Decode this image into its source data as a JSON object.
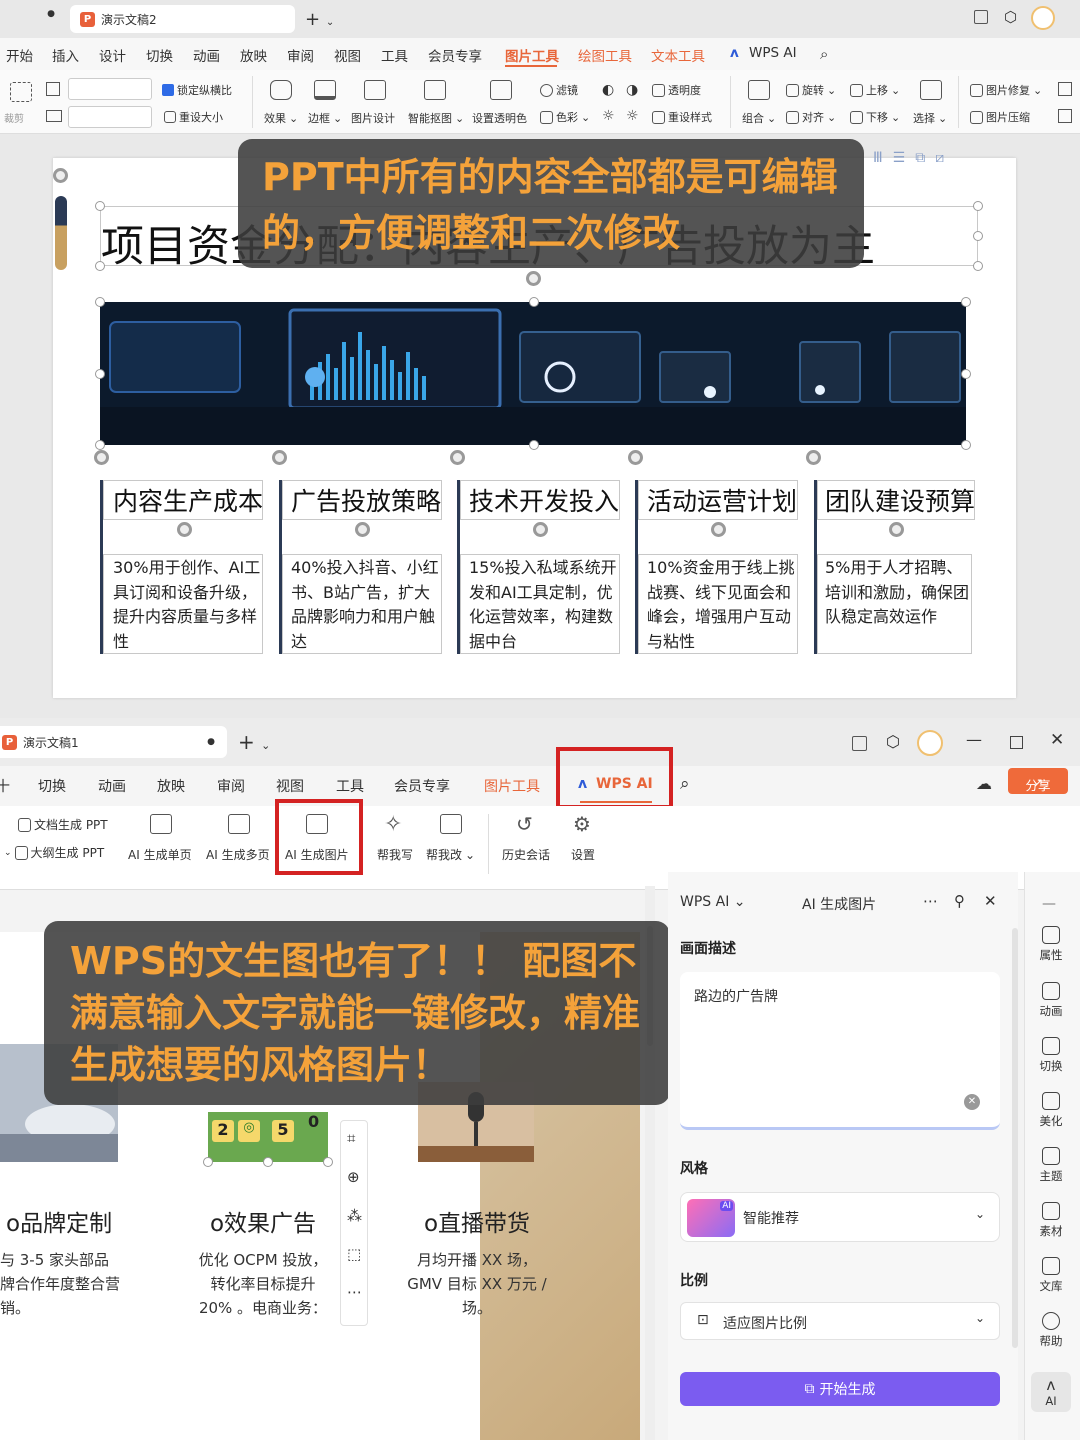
{
  "top": {
    "tab_title": "演示文稿2",
    "menu": [
      "开始",
      "插入",
      "设计",
      "切换",
      "动画",
      "放映",
      "审阅",
      "视图",
      "工具",
      "会员专享"
    ],
    "context_tabs": [
      "图片工具",
      "绘图工具",
      "文本工具"
    ],
    "wps_ai": "WPS AI",
    "ribbon": {
      "crop": "裁剪",
      "lock_ratio": "锁定纵横比",
      "reset_size": "重设大小",
      "effects": "效果",
      "border": "边框",
      "picture_design": "图片设计",
      "smart_cutout": "智能抠图",
      "set_transparent": "设置透明色",
      "filter": "滤镜",
      "color": "色彩",
      "transparency": "透明度",
      "reset_style": "重设样式",
      "rotate": "旋转",
      "align": "对齐",
      "group": "组合",
      "bring_up": "上移",
      "send_down": "下移",
      "select": "选择",
      "picture_repair": "图片修复",
      "picture_compress": "图片压缩"
    },
    "slide": {
      "title": "项目资金分配：内容生产、广告投放为主",
      "columns": [
        {
          "head": "内容生产成本",
          "text": "30%用于创作、AI工具订阅和设备升级，提升内容质量与多样性"
        },
        {
          "head": "广告投放策略",
          "text": "40%投入抖音、小红书、B站广告，扩大品牌影响力和用户触达"
        },
        {
          "head": "技术开发投入",
          "text": "15%投入私域系统开发和AI工具定制，优化运营效率，构建数据中台"
        },
        {
          "head": "活动运营计划",
          "text": "10%资金用于线上挑战赛、线下见面会和峰会，增强用户互动与粘性"
        },
        {
          "head": "团队建设预算",
          "text": "5%用于人才招聘、培训和激励，确保团队稳定高效运作"
        }
      ]
    },
    "overlay": "PPT中所有的内容全部都是可编辑的，方便调整和二次修改"
  },
  "bottom": {
    "tab_title": "演示文稿1",
    "menu": [
      "切换",
      "动画",
      "放映",
      "审阅",
      "视图",
      "工具",
      "会员专享"
    ],
    "picture_tools": "图片工具",
    "wps_ai_tab": "WPS AI",
    "share": "分享",
    "ribbon": {
      "doc_to_ppt": "文档生成 PPT",
      "outline_to_ppt": "大纲生成 PPT",
      "ai_single": "AI 生成单页",
      "ai_multi": "AI 生成多页",
      "ai_image": "AI 生成图片",
      "write": "帮我写",
      "edit": "帮我改",
      "history": "历史会话",
      "settings": "设置"
    },
    "slide_cards": [
      {
        "title": "o品牌定制",
        "text": "与 3-5 家头部品牌合作年度整合营销。"
      },
      {
        "title": "o效果广告",
        "text": "优化 OCPM 投放，转化率目标提升 20% 。电商业务："
      },
      {
        "title": "o直播带货",
        "text": "月均开播 XX 场，GMV 目标 XX 万元 / 场。"
      }
    ],
    "badge_digits": [
      "2",
      "5",
      "0"
    ],
    "overlay": "WPS的文生图也有了！！ 配图不满意输入文字就能一键修改，精准生成想要的风格图片！",
    "panel": {
      "header_left": "WPS AI",
      "header_title": "AI 生成图片",
      "desc_label": "画面描述",
      "desc_value": "路边的广告牌",
      "style_label": "风格",
      "style_value": "智能推荐",
      "ratio_label": "比例",
      "ratio_value": "适应图片比例",
      "generate": "开始生成"
    },
    "side_tools": [
      "属性",
      "动画",
      "切换",
      "美化",
      "主题",
      "素材",
      "文库",
      "帮助",
      "AI"
    ]
  },
  "colors": {
    "accent_orange": "#e8663a",
    "overlay_text": "#f4a23a",
    "generate_btn": "#7b5cf0",
    "highlight": "#d42222"
  }
}
